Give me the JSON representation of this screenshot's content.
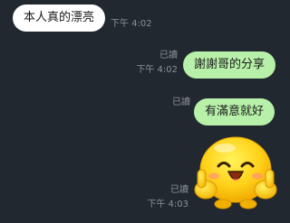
{
  "messages": [
    {
      "direction": "incoming",
      "text": "本人真的漂亮",
      "time": "下午 4:02"
    },
    {
      "direction": "outgoing",
      "text": "謝謝哥的分享",
      "read": "已讀",
      "time": "下午 4:02"
    },
    {
      "direction": "outgoing",
      "text": "有滿意就好",
      "read": "已讀"
    },
    {
      "direction": "outgoing",
      "type": "sticker",
      "sticker_icon": "happy-yellow-blob-thumbs-up-icon",
      "read": "已讀",
      "time": "下午 4:03"
    }
  ],
  "colors": {
    "background": "#22282f",
    "incoming_bubble": "#ffffff",
    "outgoing_bubble": "#b7f0a8",
    "meta_text": "#8a9199"
  }
}
